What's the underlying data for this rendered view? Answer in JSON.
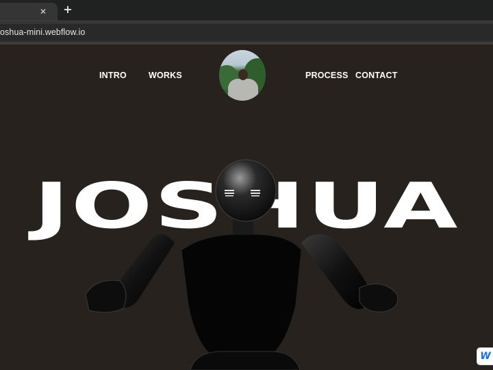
{
  "browser": {
    "tab": {
      "close_glyph": "✕"
    },
    "new_tab_glyph": "+",
    "address": "oshua-mini.webflow.io"
  },
  "nav": {
    "left": [
      {
        "label": "INTRO"
      },
      {
        "label": "WORKS"
      }
    ],
    "right": [
      {
        "label": "PROCESS"
      },
      {
        "label": "CONTACT"
      }
    ],
    "avatar_alt": "profile photo"
  },
  "hero": {
    "title": "JOSHUA",
    "image": "robot-figure"
  },
  "badge": {
    "label": "W",
    "icon": "webflow-logo",
    "color": "#146ef5"
  },
  "colors": {
    "page_bg": "#27221d",
    "text": "#ffffff",
    "chrome_dark": "#202222",
    "chrome_mid": "#353535"
  }
}
